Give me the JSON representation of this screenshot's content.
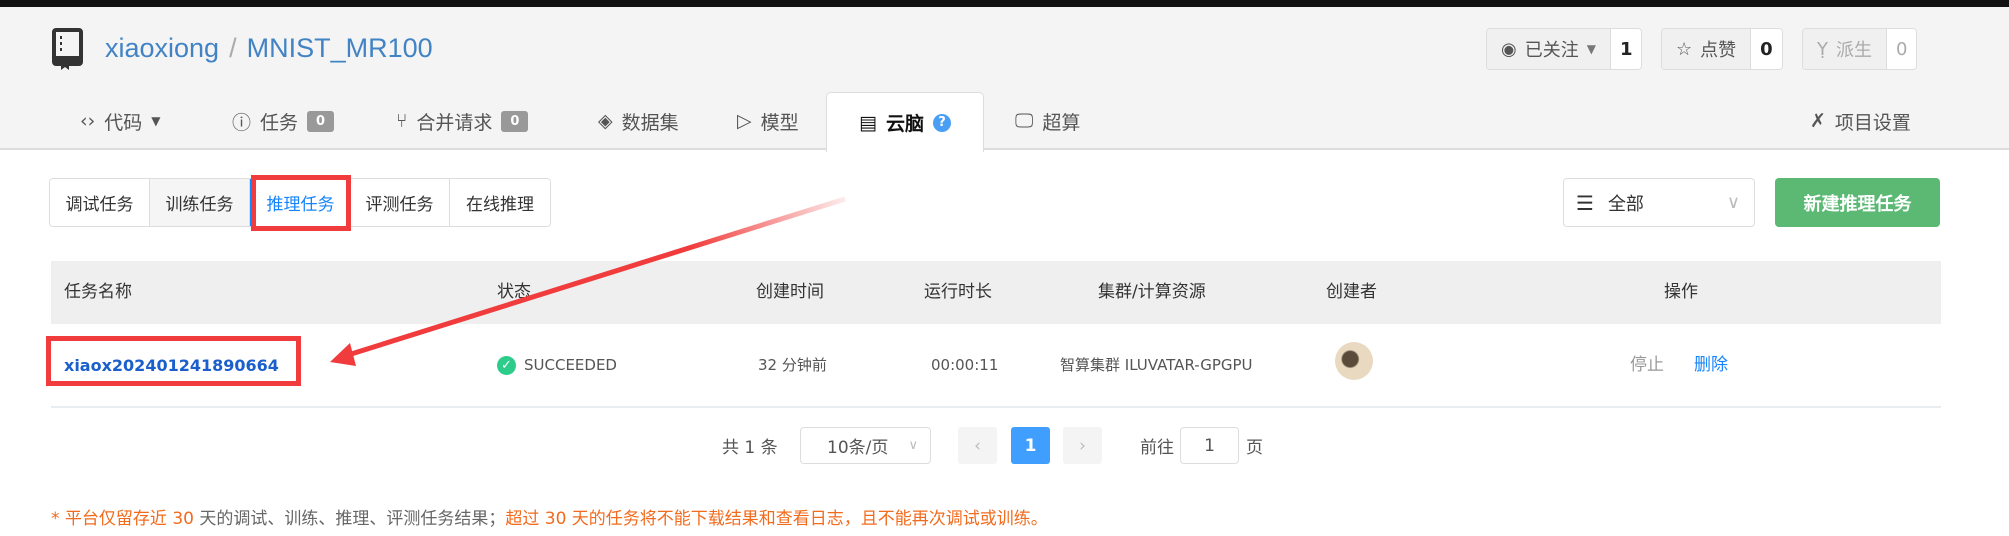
{
  "repo": {
    "owner": "xiaoxiong",
    "separator": "/",
    "name": "MNIST_MR100",
    "icon": "repo-book-icon"
  },
  "actions": [
    {
      "label": "已关注",
      "count": "1",
      "icon": "eye-icon"
    },
    {
      "label": "点赞",
      "count": "0",
      "icon": "star-icon"
    },
    {
      "label": "派生",
      "count": "0",
      "icon": "fork-icon"
    }
  ],
  "tabs": [
    {
      "label": "代码",
      "icon": "code-icon"
    },
    {
      "label": "任务",
      "count": "0",
      "icon": "issue-icon"
    },
    {
      "label": "合并请求",
      "count": "0",
      "icon": "pull-request-icon"
    },
    {
      "label": "数据集",
      "icon": "layers-icon"
    },
    {
      "label": "模型",
      "icon": "model-icon"
    },
    {
      "label": "云脑",
      "icon": "server-icon",
      "active": true
    },
    {
      "label": "超算",
      "icon": "monitor-icon"
    },
    {
      "label": "项目设置",
      "icon": "tools-icon"
    }
  ],
  "subtabs": [
    "调试任务",
    "训练任务",
    "推理任务",
    "评测任务",
    "在线推理"
  ],
  "active_subtab": "推理任务",
  "filter": {
    "value": "全部"
  },
  "new_button": "新建推理任务",
  "table": {
    "headers": [
      "任务名称",
      "状态",
      "创建时间",
      "运行时长",
      "集群/计算资源",
      "创建者",
      "操作"
    ],
    "rows": [
      {
        "name": "xiaox202401241890664",
        "status": "SUCCEEDED",
        "created": "32 分钟前",
        "duration": "00:00:11",
        "cluster": "智算集群 ILUVATAR-GPGPU",
        "actions": [
          "停止",
          "删除"
        ]
      }
    ]
  },
  "pagination": {
    "total": "共 1 条",
    "page_size": "10条/页",
    "current": "1",
    "goto_label": "前往",
    "goto_value": "1",
    "page_suffix": "页"
  },
  "note": {
    "part1": "* 平台仅留存近 ",
    "days1": "30",
    "part2": " 天的调试、训练、推理、评测任务结果；",
    "part3": "超过 30 天的任务将不能下载结果和查看日志，且不能再次调试或训练。"
  },
  "colors": {
    "accent": "#1684fc",
    "success": "#2ecc8a",
    "new_button": "#5bb974",
    "annotation": "#f03c3c",
    "warning": "#f26b1d"
  }
}
